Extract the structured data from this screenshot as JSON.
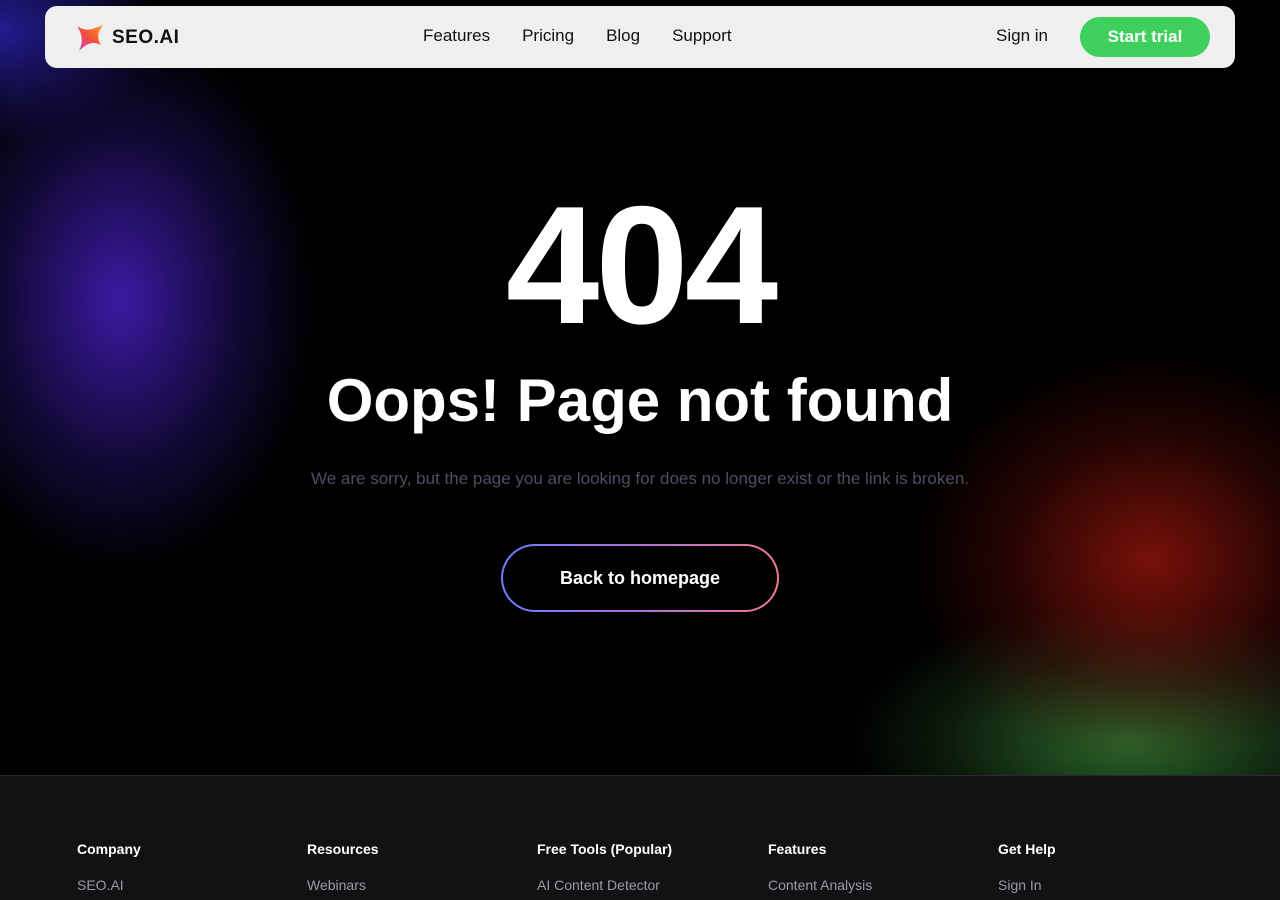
{
  "brand": {
    "name": "SEO.AI",
    "logo_icon": "star-logo-icon",
    "colors": {
      "accent_green": "#3ecf5c",
      "gradient_start": "#6f7dff",
      "gradient_end": "#f07a90"
    }
  },
  "nav": {
    "links": [
      "Features",
      "Pricing",
      "Blog",
      "Support"
    ],
    "sign_in": "Sign in",
    "start_trial": "Start trial"
  },
  "error": {
    "code": "404",
    "title": "Oops! Page not found",
    "message": "We are sorry, but the page you are looking for does no longer exist or the link is broken.",
    "button": "Back to homepage"
  },
  "footer": {
    "columns": [
      {
        "heading": "Company",
        "first_link": "SEO.AI"
      },
      {
        "heading": "Resources",
        "first_link": "Webinars"
      },
      {
        "heading": "Free Tools (Popular)",
        "first_link": "AI Content Detector"
      },
      {
        "heading": "Features",
        "first_link": "Content Analysis"
      },
      {
        "heading": "Get Help",
        "first_link": "Sign In"
      }
    ]
  }
}
